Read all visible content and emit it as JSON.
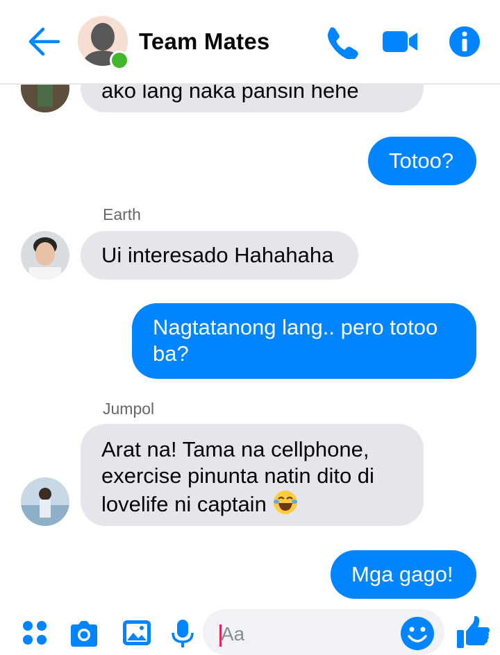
{
  "header": {
    "title": "Team Mates",
    "icons": [
      "back-arrow-icon",
      "phone-icon",
      "video-camera-icon",
      "info-icon"
    ],
    "accent": "#0084ff",
    "online_color": "#42b72a"
  },
  "messages": {
    "m1": {
      "text": "ako lang naka pansin hehe"
    },
    "m2": {
      "text": "Totoo?"
    },
    "m3": {
      "sender": "Earth",
      "text": "Ui interesado Hahahaha"
    },
    "m4": {
      "text": "Nagtatanong lang.. pero totoo ba?"
    },
    "m5": {
      "sender": "Jumpol",
      "text": "Arat na! Tama na cellphone, exercise pinunta natin dito di lovelife ni captain",
      "emoji": "joy-emoji"
    },
    "m6": {
      "text": "Mga gago!"
    }
  },
  "composer": {
    "placeholder": "Aa",
    "icons": [
      "apps-grid-icon",
      "camera-icon",
      "gallery-icon",
      "microphone-icon",
      "emoji-icon",
      "thumbs-up-icon"
    ]
  },
  "colors": {
    "incoming_bg": "#e4e6eb",
    "outgoing_bg": "#0084ff"
  }
}
